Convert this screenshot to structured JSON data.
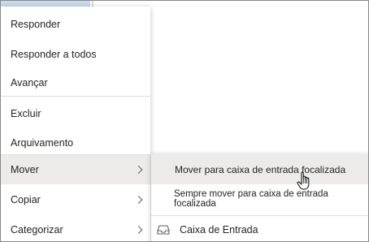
{
  "menu": {
    "items": [
      {
        "label": "Responder"
      },
      {
        "label": "Responder a todos"
      },
      {
        "label": "Avançar"
      },
      {
        "label": "Excluir"
      },
      {
        "label": "Arquivamento"
      },
      {
        "label": "Mover",
        "has_submenu": true,
        "active": true
      },
      {
        "label": "Copiar",
        "has_submenu": true
      },
      {
        "label": "Categorizar",
        "has_submenu": true
      }
    ]
  },
  "submenu": {
    "items": [
      {
        "label": "Mover para caixa de entrada focalizada",
        "active": true
      },
      {
        "label": "Sempre mover para caixa de entrada focalizada"
      },
      {
        "label": "Caixa de Entrada",
        "icon": "inbox-icon"
      }
    ]
  },
  "colors": {
    "highlight": "#edebe9",
    "selected_row": "#c7dbf0",
    "text": "#252423",
    "separator": "#e1dfdd"
  }
}
